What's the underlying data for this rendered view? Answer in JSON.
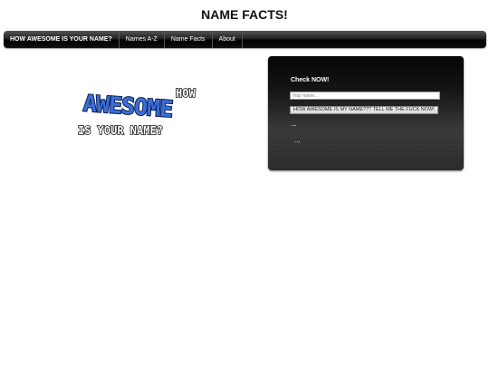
{
  "header": {
    "title": "NAME FACTS!"
  },
  "nav": {
    "items": [
      {
        "label": "HOW AWESOME IS YOUR NAME?",
        "active": true
      },
      {
        "label": "Names A-Z",
        "active": false
      },
      {
        "label": "Name Facts",
        "active": false
      },
      {
        "label": "About",
        "active": false
      }
    ]
  },
  "logo": {
    "line1": "HOW",
    "line2": "AWESOME",
    "line3": "IS YOUR NAME?",
    "accent_color": "#3a6fd8",
    "outline_color": "#111111"
  },
  "panel": {
    "title": "Check NOW!",
    "input_placeholder": "Your name...",
    "input_value": "",
    "button_label": "HOW AWESOME IS MY NAME??? TELL ME THE FUCK NOW!",
    "result_line_1": "...",
    "result_line_2": "..."
  }
}
